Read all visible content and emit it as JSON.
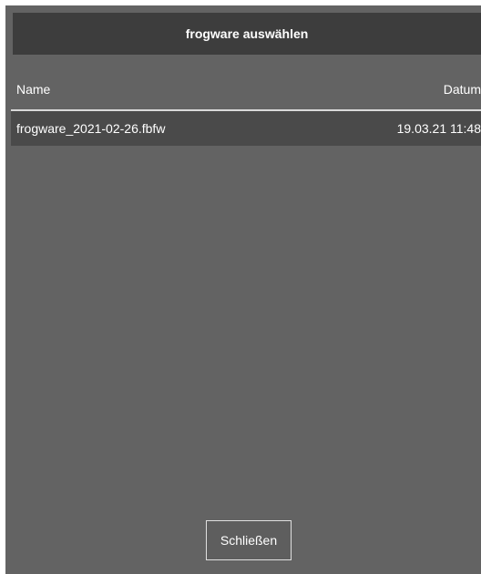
{
  "dialog": {
    "title": "frogware auswählen"
  },
  "table": {
    "columns": {
      "name": "Name",
      "date": "Datum"
    },
    "rows": [
      {
        "name": "frogware_2021-02-26.fbfw",
        "date": "19.03.21 11:48"
      }
    ]
  },
  "footer": {
    "close_label": "Schließen"
  },
  "colors": {
    "dialog_background": "#636363",
    "header_background": "#3d3d3d",
    "row_background": "#4a4a4a",
    "text": "#ffffff"
  }
}
